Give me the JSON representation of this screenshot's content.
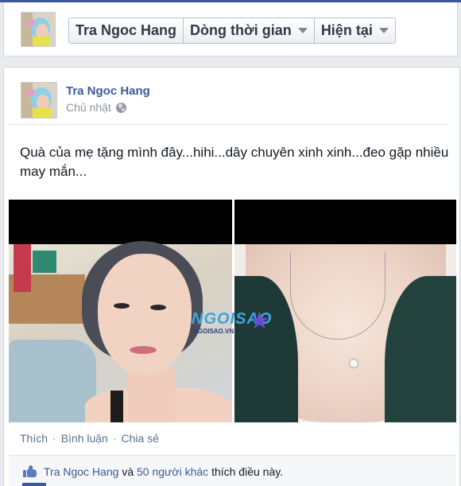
{
  "header": {
    "buttons": [
      {
        "label": "Tra Ngoc Hang",
        "dropdown": false
      },
      {
        "label": "Dòng thời gian",
        "dropdown": true
      },
      {
        "label": "Hiện tại",
        "dropdown": true
      }
    ]
  },
  "post": {
    "author": "Tra Ngoc Hang",
    "timestamp": "Chủ nhật",
    "privacy_icon": "globe-icon",
    "text": "Quà của mẹ tặng mình đây...hihi...dây chuyên xinh xinh...đeo gặp nhiều may mắn...",
    "watermark": {
      "brand": "NGOISAO",
      "site": "NGOISAO.VN"
    },
    "actions": [
      "Thích",
      "Bình luận",
      "Chia sẻ"
    ],
    "likes": {
      "name": "Tra Ngoc Hang",
      "conjunction": "và",
      "others": "50 người khác",
      "suffix": "thích điều này."
    }
  },
  "colors": {
    "brand": "#3b5998",
    "background": "#e9ebee"
  }
}
